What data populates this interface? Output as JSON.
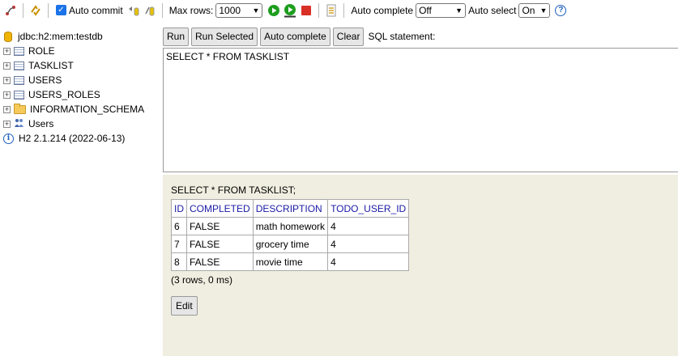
{
  "toolbar": {
    "auto_commit_label": "Auto commit",
    "auto_commit_checked": true,
    "max_rows_label": "Max rows:",
    "max_rows_value": "1000",
    "auto_complete_label": "Auto complete",
    "auto_complete_value": "Off",
    "auto_select_label": "Auto select",
    "auto_select_value": "On",
    "help_glyph": "?"
  },
  "tree": {
    "connection": "jdbc:h2:mem:testdb",
    "items": [
      {
        "label": "ROLE",
        "icon": "table-icon"
      },
      {
        "label": "TASKLIST",
        "icon": "table-icon"
      },
      {
        "label": "USERS",
        "icon": "table-icon"
      },
      {
        "label": "USERS_ROLES",
        "icon": "table-icon"
      },
      {
        "label": "INFORMATION_SCHEMA",
        "icon": "folder-icon"
      },
      {
        "label": "Users",
        "icon": "users-icon"
      }
    ],
    "version": "H2 2.1.214 (2022-06-13)"
  },
  "query": {
    "run_label": "Run",
    "run_selected_label": "Run Selected",
    "auto_complete_label": "Auto complete",
    "clear_label": "Clear",
    "sql_statement_label": "SQL statement:",
    "sql_text": "SELECT * FROM TASKLIST"
  },
  "result": {
    "statement": "SELECT * FROM TASKLIST;",
    "columns": [
      "ID",
      "COMPLETED",
      "DESCRIPTION",
      "TODO_USER_ID"
    ],
    "rows": [
      [
        "6",
        "FALSE",
        "math homework",
        "4"
      ],
      [
        "7",
        "FALSE",
        "grocery time",
        "4"
      ],
      [
        "8",
        "FALSE",
        "movie time",
        "4"
      ]
    ],
    "summary": "(3 rows, 0 ms)",
    "edit_label": "Edit"
  },
  "colors": {
    "accent_blue": "#1a73e8",
    "result_bg": "#f0eee0",
    "header_text": "#1a1aa6",
    "run_green": "#1e9e1e",
    "stop_red": "#d93025"
  }
}
